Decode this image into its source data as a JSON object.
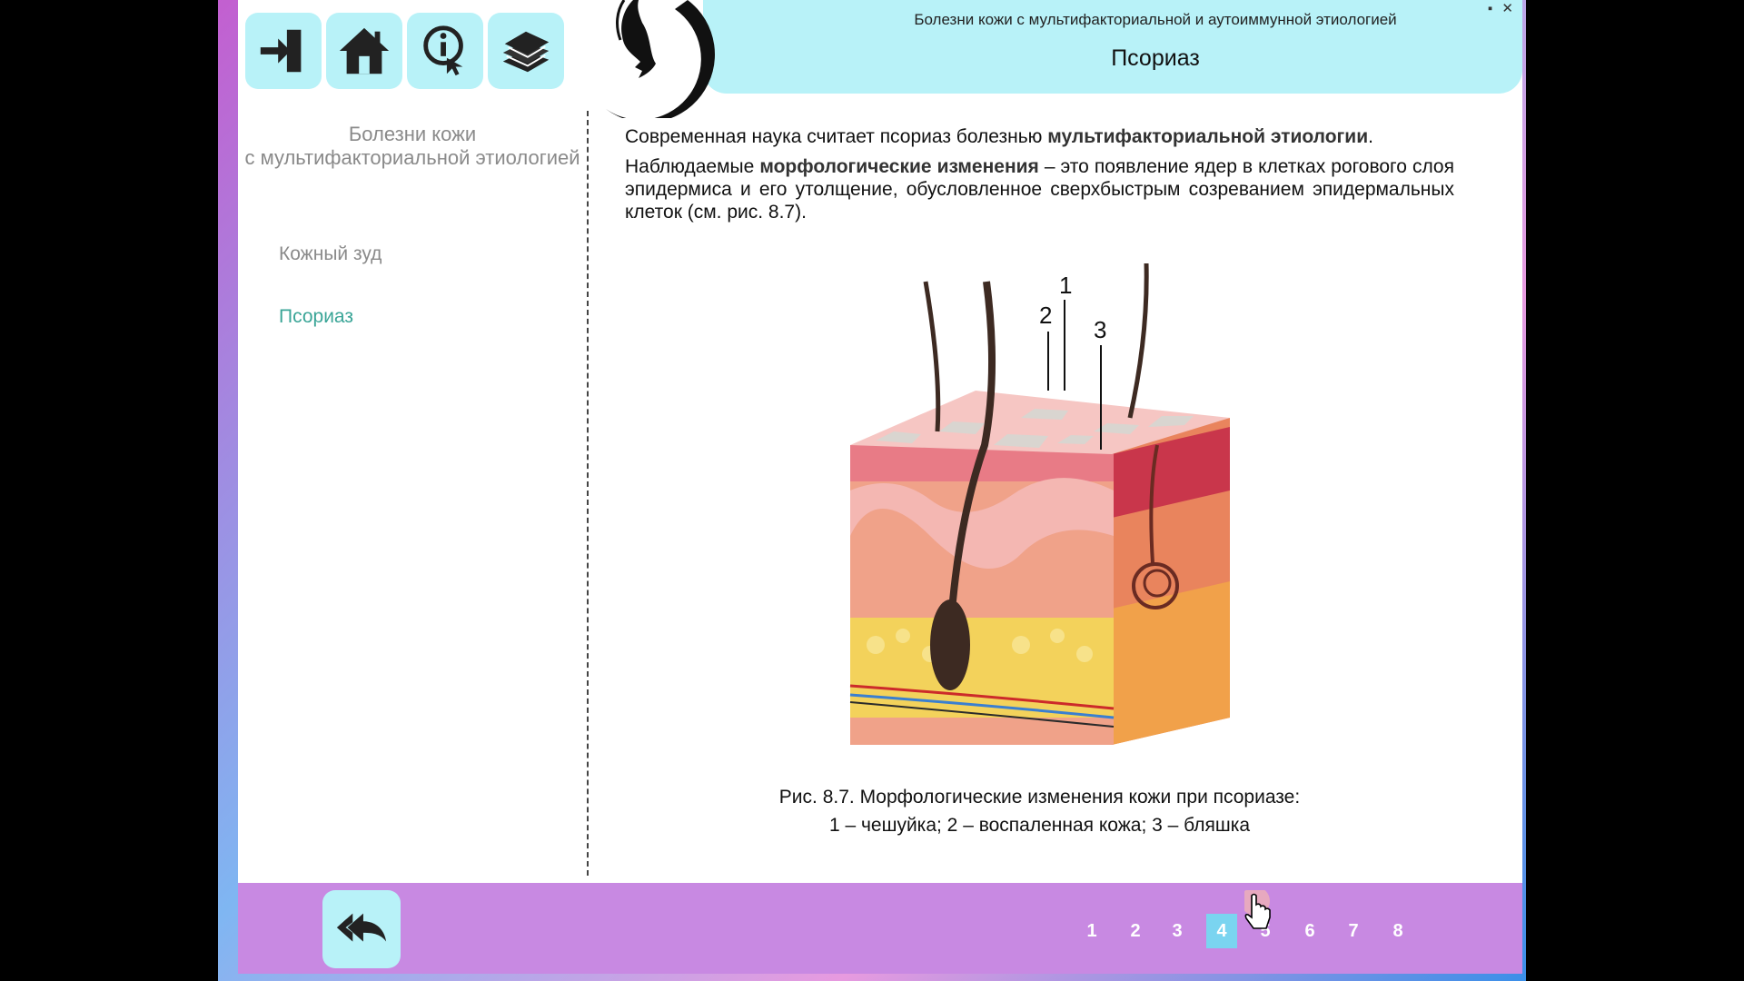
{
  "header": {
    "subtitle": "Болезни кожи с мультифакториальной и аутоиммунной этиологией",
    "title": "Псориаз"
  },
  "toolbar": {
    "icons": [
      "exit-icon",
      "home-icon",
      "info-icon",
      "books-icon"
    ]
  },
  "window_controls": {
    "minimize": "▪",
    "close": "✕"
  },
  "sidebar": {
    "title_line1": "Болезни кожи",
    "title_line2": "с мультифакториальной этиологией",
    "items": [
      {
        "label": "Кожный зуд"
      },
      {
        "label": "Псориаз"
      }
    ]
  },
  "content": {
    "p1_a": "Современная наука считает псориаз болезнью ",
    "p1_b": "мультифакториальной этиологии",
    "p1_c": ".",
    "p2_a": "Наблюдаемые ",
    "p2_b": "морфологические изменения",
    "p2_c": " – это появление ядер в клетках рогового слоя эпидермиса и его утолщение, обусловленное сверхбыстрым созреванием эпидермальных клеток (см. рис. 8.7)."
  },
  "figure": {
    "labels": [
      "1",
      "2",
      "3"
    ],
    "caption_line1": "Рис. 8.7. Морфологические изменения кожи при псориазе:",
    "caption_line2": "1 – чешуйка; 2 – воспаленная кожа; 3 – бляшка"
  },
  "pagination": {
    "pages": [
      "1",
      "2",
      "3",
      "4",
      "5",
      "6",
      "7",
      "8"
    ],
    "current": "4"
  },
  "colors": {
    "accent": "#b8f2f8",
    "footer": "#c889e2",
    "active_item": "#3aa597",
    "active_page": "#7ad4f0"
  }
}
